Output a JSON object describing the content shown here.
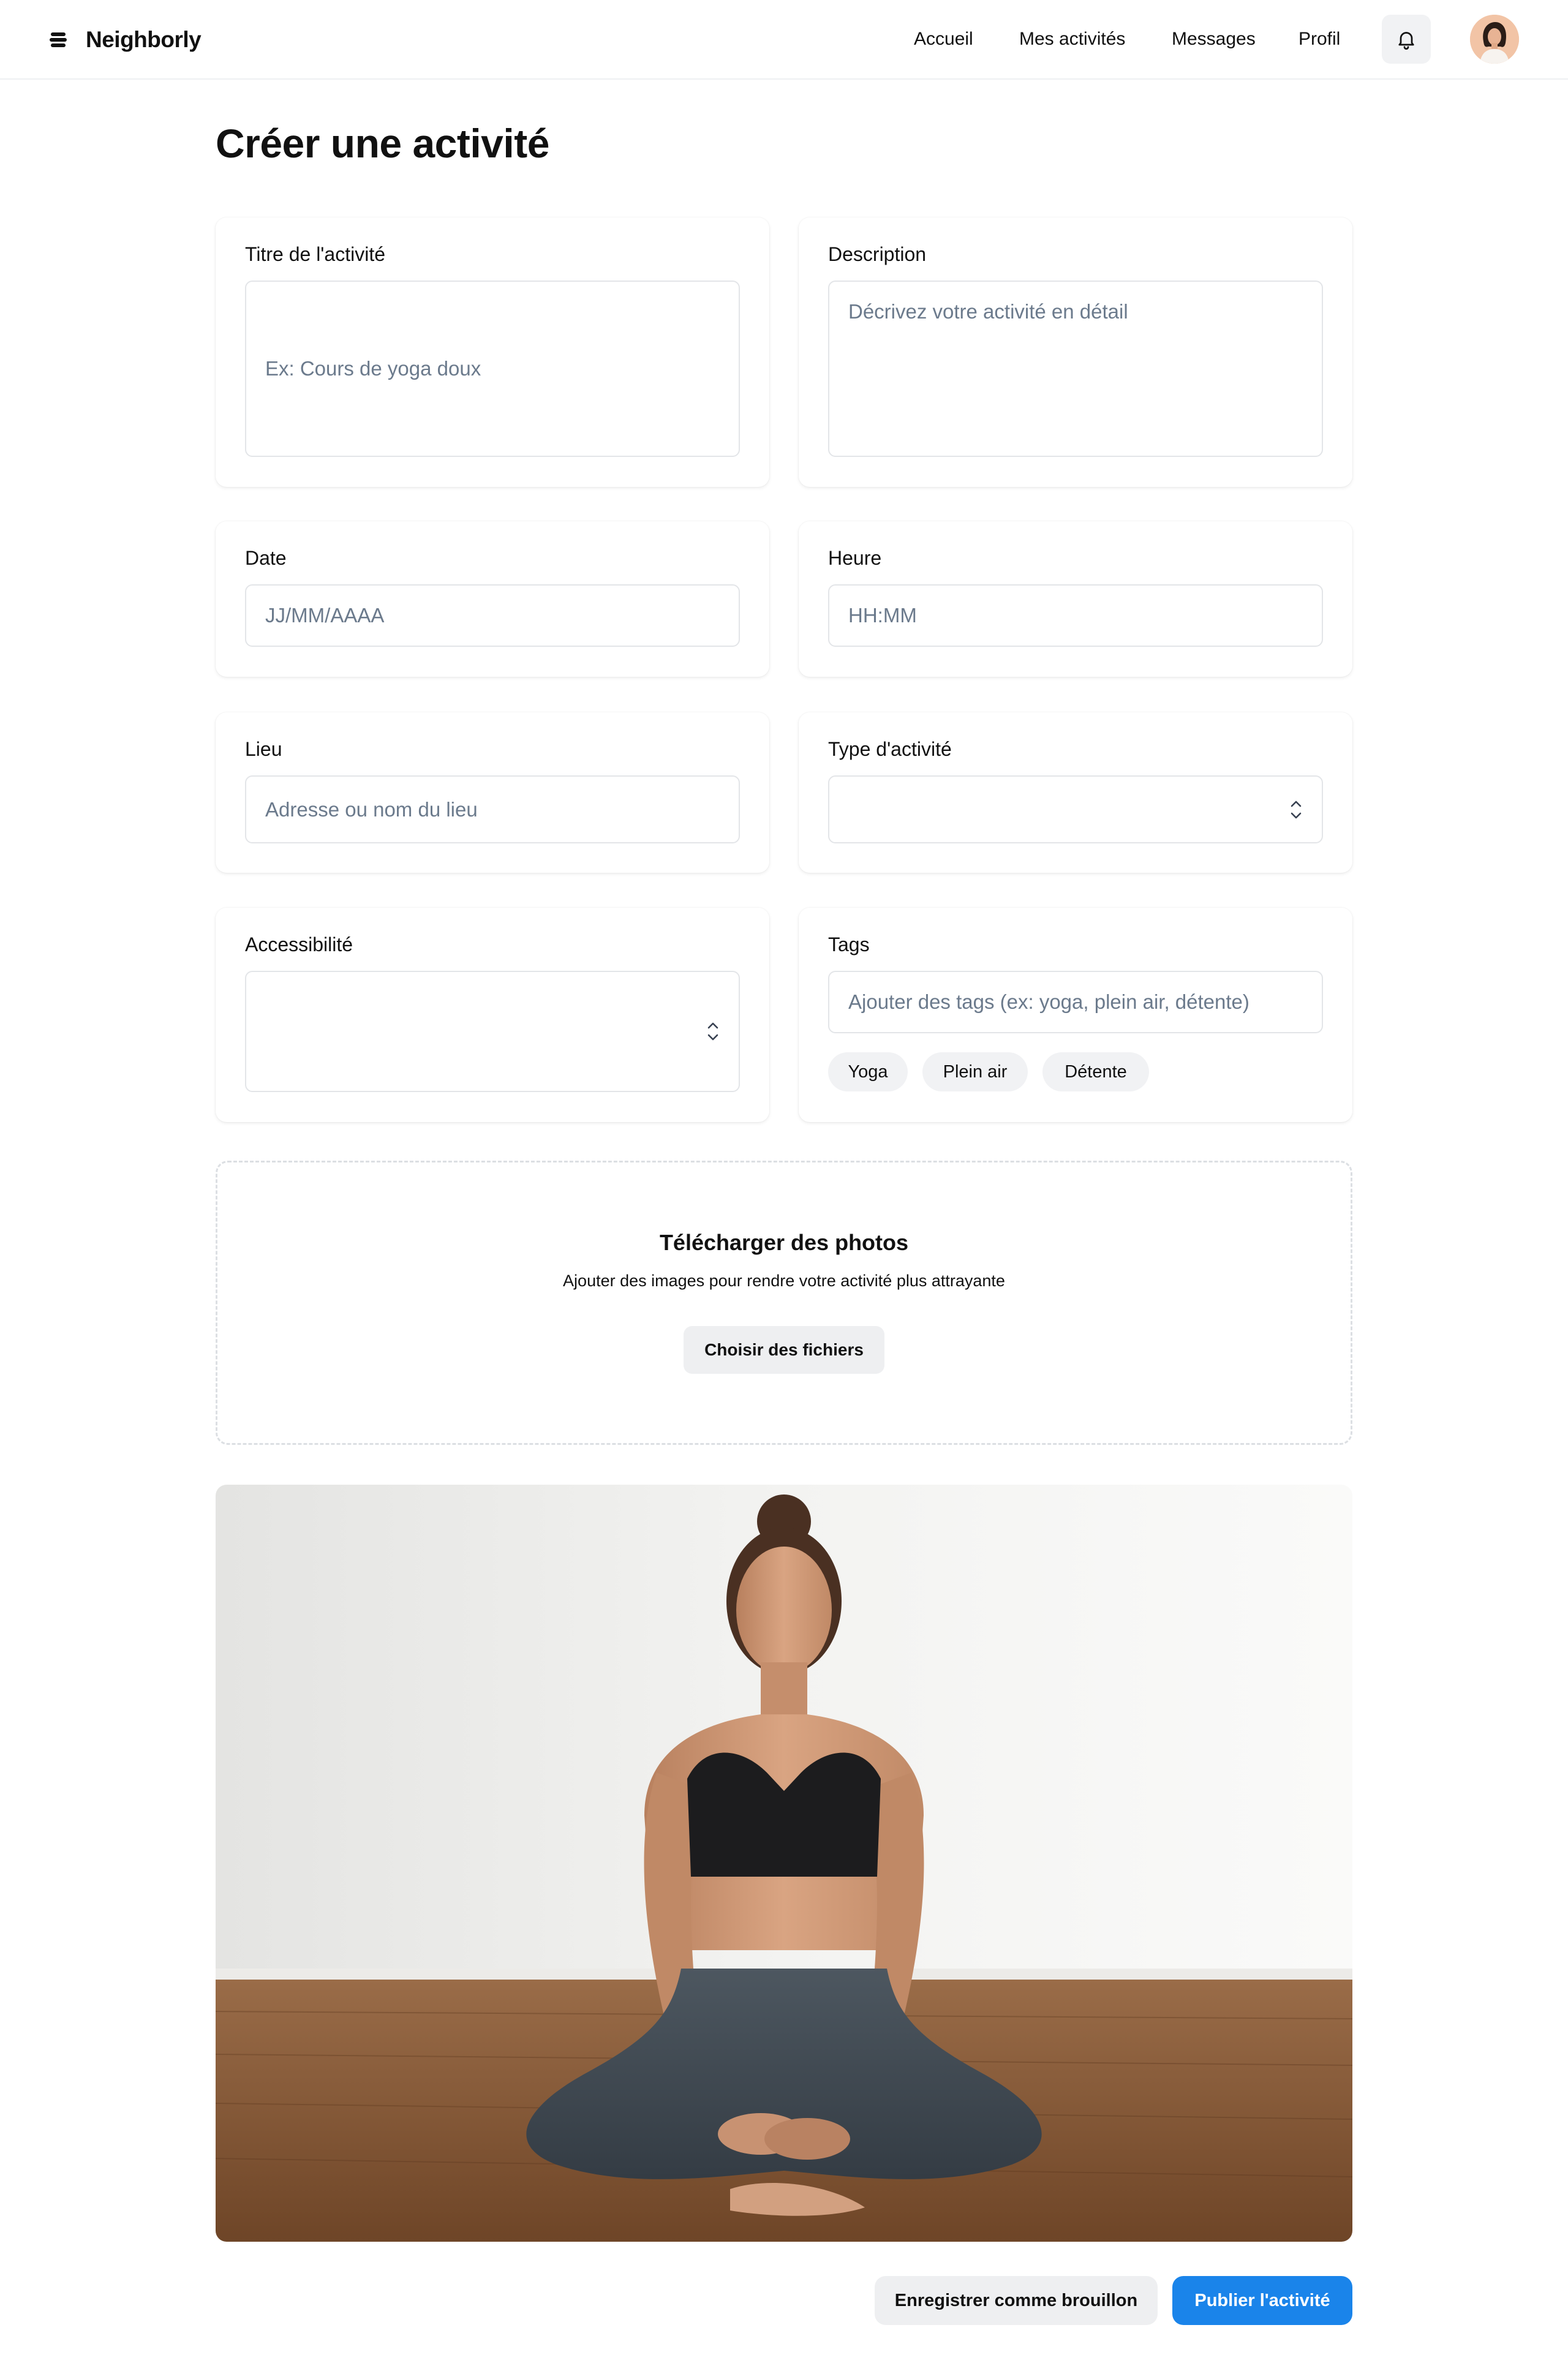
{
  "app": {
    "brand": "Neighborly"
  },
  "nav": {
    "items": [
      {
        "label": "Accueil"
      },
      {
        "label": "Mes activités"
      },
      {
        "label": "Messages"
      },
      {
        "label": "Profil"
      }
    ],
    "bell_icon": "bell-icon",
    "avatar_icon": "user-avatar"
  },
  "page": {
    "title": "Créer une activité"
  },
  "form": {
    "title": {
      "label": "Titre de l'activité",
      "placeholder": "Ex: Cours de yoga doux"
    },
    "description": {
      "label": "Description",
      "placeholder": "Décrivez votre activité en détail"
    },
    "date": {
      "label": "Date",
      "placeholder": "JJ/MM/AAAA"
    },
    "time": {
      "label": "Heure",
      "placeholder": "HH:MM"
    },
    "location": {
      "label": "Lieu",
      "placeholder": "Adresse ou nom du lieu"
    },
    "activity_type": {
      "label": "Type d'activité",
      "value": ""
    },
    "accessibility": {
      "label": "Accessibilité",
      "value": ""
    },
    "tags": {
      "label": "Tags",
      "placeholder": "Ajouter des tags (ex: yoga, plein air, détente)",
      "items": [
        "Yoga",
        "Plein air",
        "Détente"
      ]
    }
  },
  "upload": {
    "title": "Télécharger des photos",
    "subtitle": "Ajouter des images pour rendre votre activité plus attrayante",
    "button": "Choisir des fichiers"
  },
  "actions": {
    "draft": "Enregistrer comme brouillon",
    "publish": "Publier l'activité"
  },
  "colors": {
    "accent": "#1a84ea",
    "placeholder": "#6b7a8c",
    "chip_bg": "#f1f2f4"
  }
}
